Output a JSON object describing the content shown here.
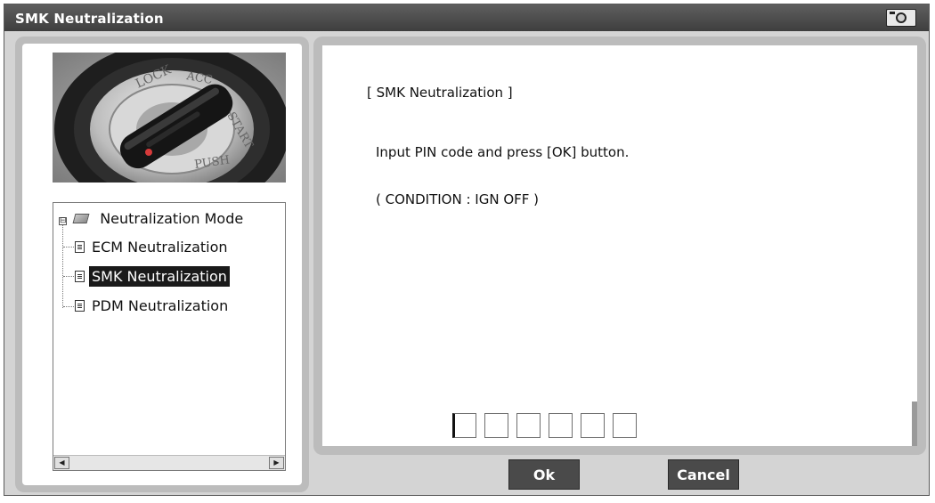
{
  "window": {
    "title": "SMK Neutralization",
    "camera_icon": "camera-icon"
  },
  "tree": {
    "root": {
      "label": "Neutralization Mode",
      "expander": "⊟"
    },
    "items": [
      {
        "label": "ECM Neutralization",
        "selected": false
      },
      {
        "label": "SMK Neutralization",
        "selected": true
      },
      {
        "label": "PDM Neutralization",
        "selected": false
      }
    ],
    "scroll_left": "◀",
    "scroll_right": "▶"
  },
  "panel": {
    "heading": "[ SMK Neutralization ]",
    "instruction": "Input PIN code and press [OK] button.",
    "condition": "( CONDITION : IGN OFF )",
    "pin_values": [
      "",
      "",
      "",
      "",
      "",
      ""
    ]
  },
  "buttons": {
    "ok": "Ok",
    "cancel": "Cancel"
  },
  "colors": {
    "titlebar": "#4a4a4a",
    "frame": "#bcbcbc",
    "selection": "#1a1a1a",
    "button": "#4a4a4a"
  }
}
